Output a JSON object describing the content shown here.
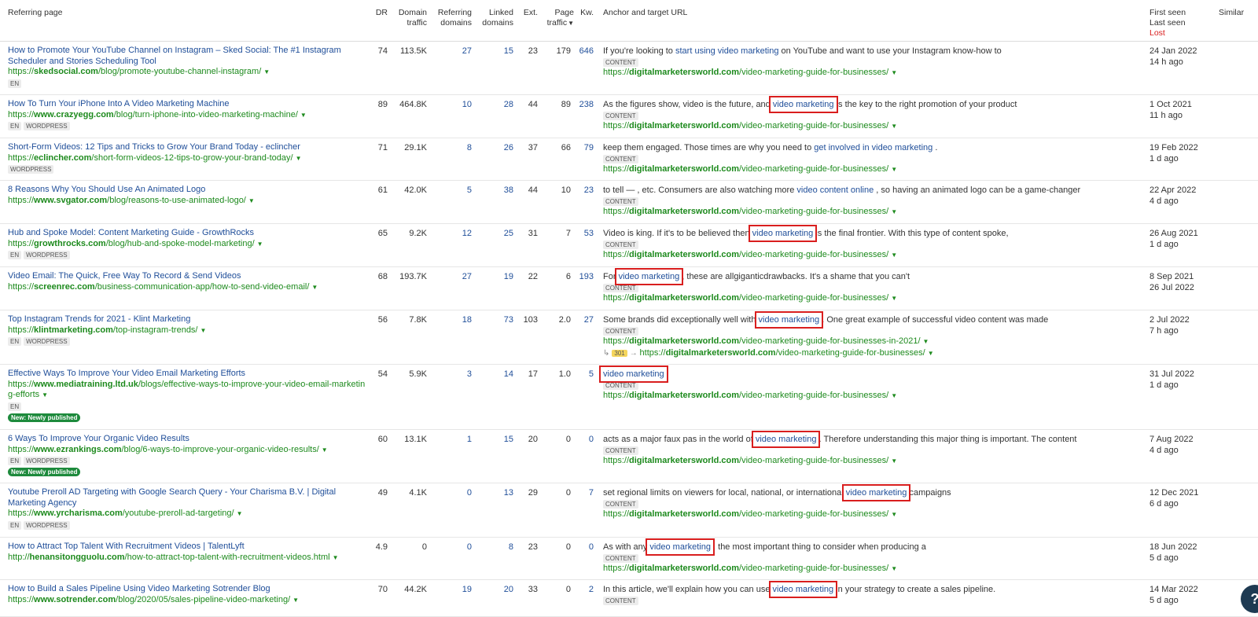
{
  "headers": {
    "referring_page": "Referring page",
    "dr": "DR",
    "domain_traffic": [
      "Domain",
      "traffic"
    ],
    "referring_domains": [
      "Referring",
      "domains"
    ],
    "linked_domains": [
      "Linked",
      "domains"
    ],
    "ext": "Ext.",
    "page_traffic": [
      "Page",
      "traffic"
    ],
    "kw": "Kw.",
    "anchor": "Anchor and target URL",
    "first_seen": "First seen",
    "last_seen": "Last seen",
    "lost": "Lost",
    "similar": "Similar"
  },
  "colors": {
    "link": "#1f4e99",
    "url": "#1d8a1d",
    "highlight_box": "#d91e1e",
    "lost": "#d91e1e",
    "new_badge": "#1d8a3c"
  },
  "rows": [
    {
      "title": "How to Promote Your YouTube Channel on Instagram – Sked Social: The #1 Instagram Scheduler and Stories Scheduling Tool",
      "title2": "",
      "url_prefix": "https://",
      "url_domain": "skedsocial.com",
      "url_path": "/blog/promote-youtube-channel-instagram/",
      "url_path2": "",
      "tags": [
        "EN"
      ],
      "badge": "",
      "dr": "74",
      "domain_traffic": "113.5K",
      "ref_domains": "27",
      "linked_domains": "15",
      "ext": "23",
      "page_traffic": "179",
      "kw": "646",
      "anchor_before": "If you're looking to ",
      "anchor_link": "start using video marketing",
      "anchor_after": " on YouTube and want to use your Instagram know-how to",
      "boxed": false,
      "content_tag": "CONTENT",
      "target_prefix": "https://",
      "target_domain": "digitalmarketersworld.com",
      "target_path": "/video-marketing-guide-for-businesses/",
      "redirect_code": "",
      "redirect_prefix": "",
      "redirect_domain": "",
      "redirect_path": "",
      "first_seen": "24 Jan 2022",
      "last_seen": "14 h ago"
    },
    {
      "title": "How To Turn Your iPhone Into A Video Marketing Machine",
      "title2": "",
      "url_prefix": "https://",
      "url_domain": "www.crazyegg.com",
      "url_path": "/blog/turn-iphone-into-video-marketing-machine/",
      "url_path2": "",
      "tags": [
        "EN",
        "WORDPRESS"
      ],
      "badge": "",
      "dr": "89",
      "domain_traffic": "464.8K",
      "ref_domains": "10",
      "linked_domains": "28",
      "ext": "44",
      "page_traffic": "89",
      "kw": "238",
      "anchor_before": "As the figures show, video is the future, and ",
      "anchor_link": "video marketing",
      "anchor_after": " is the key to the right promotion of your product",
      "boxed": true,
      "content_tag": "CONTENT",
      "target_prefix": "https://",
      "target_domain": "digitalmarketersworld.com",
      "target_path": "/video-marketing-guide-for-businesses/",
      "redirect_code": "",
      "redirect_prefix": "",
      "redirect_domain": "",
      "redirect_path": "",
      "first_seen": "1 Oct 2021",
      "last_seen": "11 h ago"
    },
    {
      "title": "Short-Form Videos: 12 Tips and Tricks to Grow Your Brand Today - eclincher",
      "title2": "",
      "url_prefix": "https://",
      "url_domain": "eclincher.com",
      "url_path": "/short-form-videos-12-tips-to-grow-your-brand-today/",
      "url_path2": "",
      "tags": [
        "WORDPRESS"
      ],
      "badge": "",
      "dr": "71",
      "domain_traffic": "29.1K",
      "ref_domains": "8",
      "linked_domains": "26",
      "ext": "37",
      "page_traffic": "66",
      "kw": "79",
      "anchor_before": "keep them engaged. Those times are why you need to ",
      "anchor_link": "get involved in video marketing",
      "anchor_after": " .",
      "boxed": false,
      "content_tag": "CONTENT",
      "target_prefix": "https://",
      "target_domain": "digitalmarketersworld.com",
      "target_path": "/video-marketing-guide-for-businesses/",
      "redirect_code": "",
      "redirect_prefix": "",
      "redirect_domain": "",
      "redirect_path": "",
      "first_seen": "19 Feb 2022",
      "last_seen": "1 d ago"
    },
    {
      "title": "8 Reasons Why You Should Use An Animated Logo",
      "title2": "",
      "url_prefix": "https://",
      "url_domain": "www.svgator.com",
      "url_path": "/blog/reasons-to-use-animated-logo/",
      "url_path2": "",
      "tags": [],
      "badge": "",
      "dr": "61",
      "domain_traffic": "42.0K",
      "ref_domains": "5",
      "linked_domains": "38",
      "ext": "44",
      "page_traffic": "10",
      "kw": "23",
      "anchor_before": "to tell — , etc. Consumers are also watching more ",
      "anchor_link": "video content online",
      "anchor_after": " , so having an animated logo can be a game-changer",
      "boxed": false,
      "content_tag": "CONTENT",
      "target_prefix": "https://",
      "target_domain": "digitalmarketersworld.com",
      "target_path": "/video-marketing-guide-for-businesses/",
      "redirect_code": "",
      "redirect_prefix": "",
      "redirect_domain": "",
      "redirect_path": "",
      "first_seen": "22 Apr 2022",
      "last_seen": "4 d ago"
    },
    {
      "title": "Hub and Spoke Model: Content Marketing Guide - GrowthRocks",
      "title2": "",
      "url_prefix": "https://",
      "url_domain": "growthrocks.com",
      "url_path": "/blog/hub-and-spoke-model-marketing/",
      "url_path2": "",
      "tags": [
        "EN",
        "WORDPRESS"
      ],
      "badge": "",
      "dr": "65",
      "domain_traffic": "9.2K",
      "ref_domains": "12",
      "linked_domains": "25",
      "ext": "31",
      "page_traffic": "7",
      "kw": "53",
      "anchor_before": "Video is king. If it's to be believed then ",
      "anchor_link": "video marketing",
      "anchor_after": " is the final frontier. With this type of content spoke,",
      "boxed": true,
      "content_tag": "CONTENT",
      "target_prefix": "https://",
      "target_domain": "digitalmarketersworld.com",
      "target_path": "/video-marketing-guide-for-businesses/",
      "redirect_code": "",
      "redirect_prefix": "",
      "redirect_domain": "",
      "redirect_path": "",
      "first_seen": "26 Aug 2021",
      "last_seen": "1 d ago"
    },
    {
      "title": "Video Email: The Quick, Free Way To Record & Send Videos",
      "title2": "",
      "url_prefix": "https://",
      "url_domain": "screenrec.com",
      "url_path": "/business-communication-app/how-to-send-video-email/",
      "url_path2": "",
      "tags": [],
      "badge": "",
      "dr": "68",
      "domain_traffic": "193.7K",
      "ref_domains": "27",
      "linked_domains": "19",
      "ext": "22",
      "page_traffic": "6",
      "kw": "193",
      "anchor_before": "For ",
      "anchor_link": "video marketing",
      "anchor_after": " , these are allgiganticdrawbacks. It's a shame that you can't",
      "boxed": true,
      "content_tag": "CONTENT",
      "target_prefix": "https://",
      "target_domain": "digitalmarketersworld.com",
      "target_path": "/video-marketing-guide-for-businesses/",
      "redirect_code": "",
      "redirect_prefix": "",
      "redirect_domain": "",
      "redirect_path": "",
      "first_seen": "8 Sep 2021",
      "last_seen": "26 Jul 2022"
    },
    {
      "title": "Top Instagram Trends for 2021 - Klint Marketing",
      "title2": "",
      "url_prefix": "https://",
      "url_domain": "klintmarketing.com",
      "url_path": "/top-instagram-trends/",
      "url_path2": "",
      "tags": [
        "EN",
        "WORDPRESS"
      ],
      "badge": "",
      "dr": "56",
      "domain_traffic": "7.8K",
      "ref_domains": "18",
      "linked_domains": "73",
      "ext": "103",
      "page_traffic": "2.0",
      "kw": "27",
      "anchor_before": "Some brands did exceptionally well with ",
      "anchor_link": "video marketing",
      "anchor_after": " . One great example of successful video content was made",
      "boxed": true,
      "content_tag": "CONTENT",
      "target_prefix": "https://",
      "target_domain": "digitalmarketersworld.com",
      "target_path": "/video-marketing-guide-for-businesses-in-2021/",
      "redirect_code": "301",
      "redirect_prefix": "https://",
      "redirect_domain": "digitalmarketersworld.com",
      "redirect_path": "/video-marketing-guide-for-businesses/",
      "first_seen": "2 Jul 2022",
      "last_seen": "7 h ago"
    },
    {
      "title": "Effective Ways To Improve Your Video Email Marketing Efforts",
      "title2": "",
      "url_prefix": "https://",
      "url_domain": "www.mediatraining.ltd.uk",
      "url_path": "/blogs/effective-ways-to-improve-your-video-email-marketin",
      "url_path2": "g-efforts",
      "tags": [
        "EN"
      ],
      "badge": "New: Newly published",
      "dr": "54",
      "domain_traffic": "5.9K",
      "ref_domains": "3",
      "linked_domains": "14",
      "ext": "17",
      "page_traffic": "1.0",
      "kw": "5",
      "anchor_before": "",
      "anchor_link": "video marketing",
      "anchor_after": "",
      "boxed": true,
      "content_tag": "CONTENT",
      "target_prefix": "https://",
      "target_domain": "digitalmarketersworld.com",
      "target_path": "/video-marketing-guide-for-businesses/",
      "redirect_code": "",
      "redirect_prefix": "",
      "redirect_domain": "",
      "redirect_path": "",
      "first_seen": "31 Jul 2022",
      "last_seen": "1 d ago"
    },
    {
      "title": "6 Ways To Improve Your Organic Video Results",
      "title2": "",
      "url_prefix": "https://",
      "url_domain": "www.ezrankings.com",
      "url_path": "/blog/6-ways-to-improve-your-organic-video-results/",
      "url_path2": "",
      "tags": [
        "EN",
        "WORDPRESS"
      ],
      "badge": "New: Newly published",
      "dr": "60",
      "domain_traffic": "13.1K",
      "ref_domains": "1",
      "linked_domains": "15",
      "ext": "20",
      "page_traffic": "0",
      "kw": "0",
      "anchor_before": "acts as a major faux pas in the world of ",
      "anchor_link": "video marketing",
      "anchor_after": " . Therefore understanding this major thing is important. The content",
      "boxed": true,
      "content_tag": "CONTENT",
      "target_prefix": "https://",
      "target_domain": "digitalmarketersworld.com",
      "target_path": "/video-marketing-guide-for-businesses/",
      "redirect_code": "",
      "redirect_prefix": "",
      "redirect_domain": "",
      "redirect_path": "",
      "first_seen": "7 Aug 2022",
      "last_seen": "4 d ago"
    },
    {
      "title": "Youtube Preroll AD Targeting with Google Search Query - Your Charisma B.V. | Digital",
      "title2": "Marketing Agency",
      "url_prefix": "https://",
      "url_domain": "www.yrcharisma.com",
      "url_path": "/youtube-preroll-ad-targeting/",
      "url_path2": "",
      "tags": [
        "EN",
        "WORDPRESS"
      ],
      "badge": "",
      "dr": "49",
      "domain_traffic": "4.1K",
      "ref_domains": "0",
      "linked_domains": "13",
      "ext": "29",
      "page_traffic": "0",
      "kw": "7",
      "anchor_before": "set regional limits on viewers for local, national, or international ",
      "anchor_link": "video marketing",
      "anchor_after": " campaigns",
      "boxed": true,
      "content_tag": "CONTENT",
      "target_prefix": "https://",
      "target_domain": "digitalmarketersworld.com",
      "target_path": "/video-marketing-guide-for-businesses/",
      "redirect_code": "",
      "redirect_prefix": "",
      "redirect_domain": "",
      "redirect_path": "",
      "first_seen": "12 Dec 2021",
      "last_seen": "6 d ago"
    },
    {
      "title": "How to Attract Top Talent With Recruitment Videos | TalentLyft",
      "title2": "",
      "url_prefix": "http://",
      "url_domain": "henansitongguolu.com",
      "url_path": "/how-to-attract-top-talent-with-recruitment-videos.html",
      "url_path2": "",
      "tags": [],
      "badge": "",
      "dr": "4.9",
      "domain_traffic": "0",
      "ref_domains": "0",
      "linked_domains": "8",
      "ext": "23",
      "page_traffic": "0",
      "kw": "0",
      "anchor_before": "As with any ",
      "anchor_link": "video marketing",
      "anchor_after": " , the most important thing to consider when producing a",
      "boxed": true,
      "content_tag": "CONTENT",
      "target_prefix": "https://",
      "target_domain": "digitalmarketersworld.com",
      "target_path": "/video-marketing-guide-for-businesses/",
      "redirect_code": "",
      "redirect_prefix": "",
      "redirect_domain": "",
      "redirect_path": "",
      "first_seen": "18 Jun 2022",
      "last_seen": "5 d ago"
    },
    {
      "title": "How to Build a Sales Pipeline Using Video Marketing Sotrender Blog",
      "title2": "",
      "url_prefix": "https://",
      "url_domain": "www.sotrender.com",
      "url_path": "/blog/2020/05/sales-pipeline-video-marketing/",
      "url_path2": "",
      "tags": [],
      "badge": "",
      "dr": "70",
      "domain_traffic": "44.2K",
      "ref_domains": "19",
      "linked_domains": "20",
      "ext": "33",
      "page_traffic": "0",
      "kw": "2",
      "anchor_before": "In this article, we'll explain how you can use ",
      "anchor_link": "video marketing",
      "anchor_after": " in your strategy to create a sales pipeline.",
      "boxed": true,
      "content_tag": "CONTENT",
      "target_prefix": "",
      "target_domain": "",
      "target_path": "",
      "redirect_code": "",
      "redirect_prefix": "",
      "redirect_domain": "",
      "redirect_path": "",
      "first_seen": "14 Mar 2022",
      "last_seen": "5 d ago"
    }
  ],
  "help_label": "?"
}
